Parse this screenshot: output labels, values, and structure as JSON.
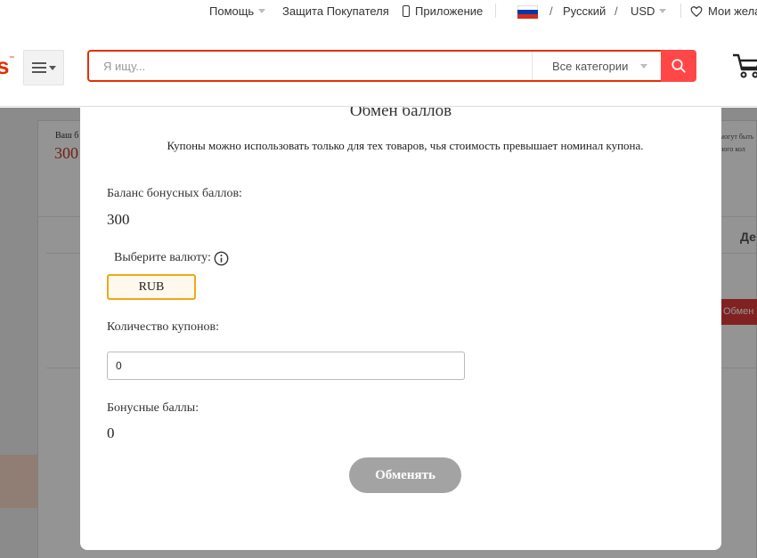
{
  "topbar": {
    "help": "Помощь",
    "buyer_protection": "Защита Покупателя",
    "app": "Приложение",
    "language": "Русский",
    "currency": "USD",
    "wishlist": "Мои жела"
  },
  "header": {
    "logo_fragment": "s",
    "logo_tm": "™",
    "search_placeholder": "Я ищу...",
    "category": "Все категории",
    "brand_color": "#e62e04",
    "search_button_color": "#ff4747"
  },
  "background_page": {
    "balance_label_fragment": "Ваш б",
    "balance_value_fragment": "300",
    "right_text_1": "могут быть",
    "right_text_2": "ного кол",
    "right_heading_fragment": "Де",
    "right_button_fragment": "Обмен"
  },
  "modal": {
    "title": "Обмен баллов",
    "note": "Купоны можно использовать только для тех товаров, чья стоимость превышает номинал купона.",
    "balance_label": "Баланс бонусных баллов:",
    "balance_value": "300",
    "currency_label": "Выберите валюту:",
    "currency_selected": "RUB",
    "coupon_qty_label": "Количество купонов:",
    "coupon_qty_value": "0",
    "bonus_points_label": "Бонусные баллы:",
    "bonus_points_value": "0",
    "exchange_button": "Обменять",
    "accent_color": "#f0a818"
  }
}
